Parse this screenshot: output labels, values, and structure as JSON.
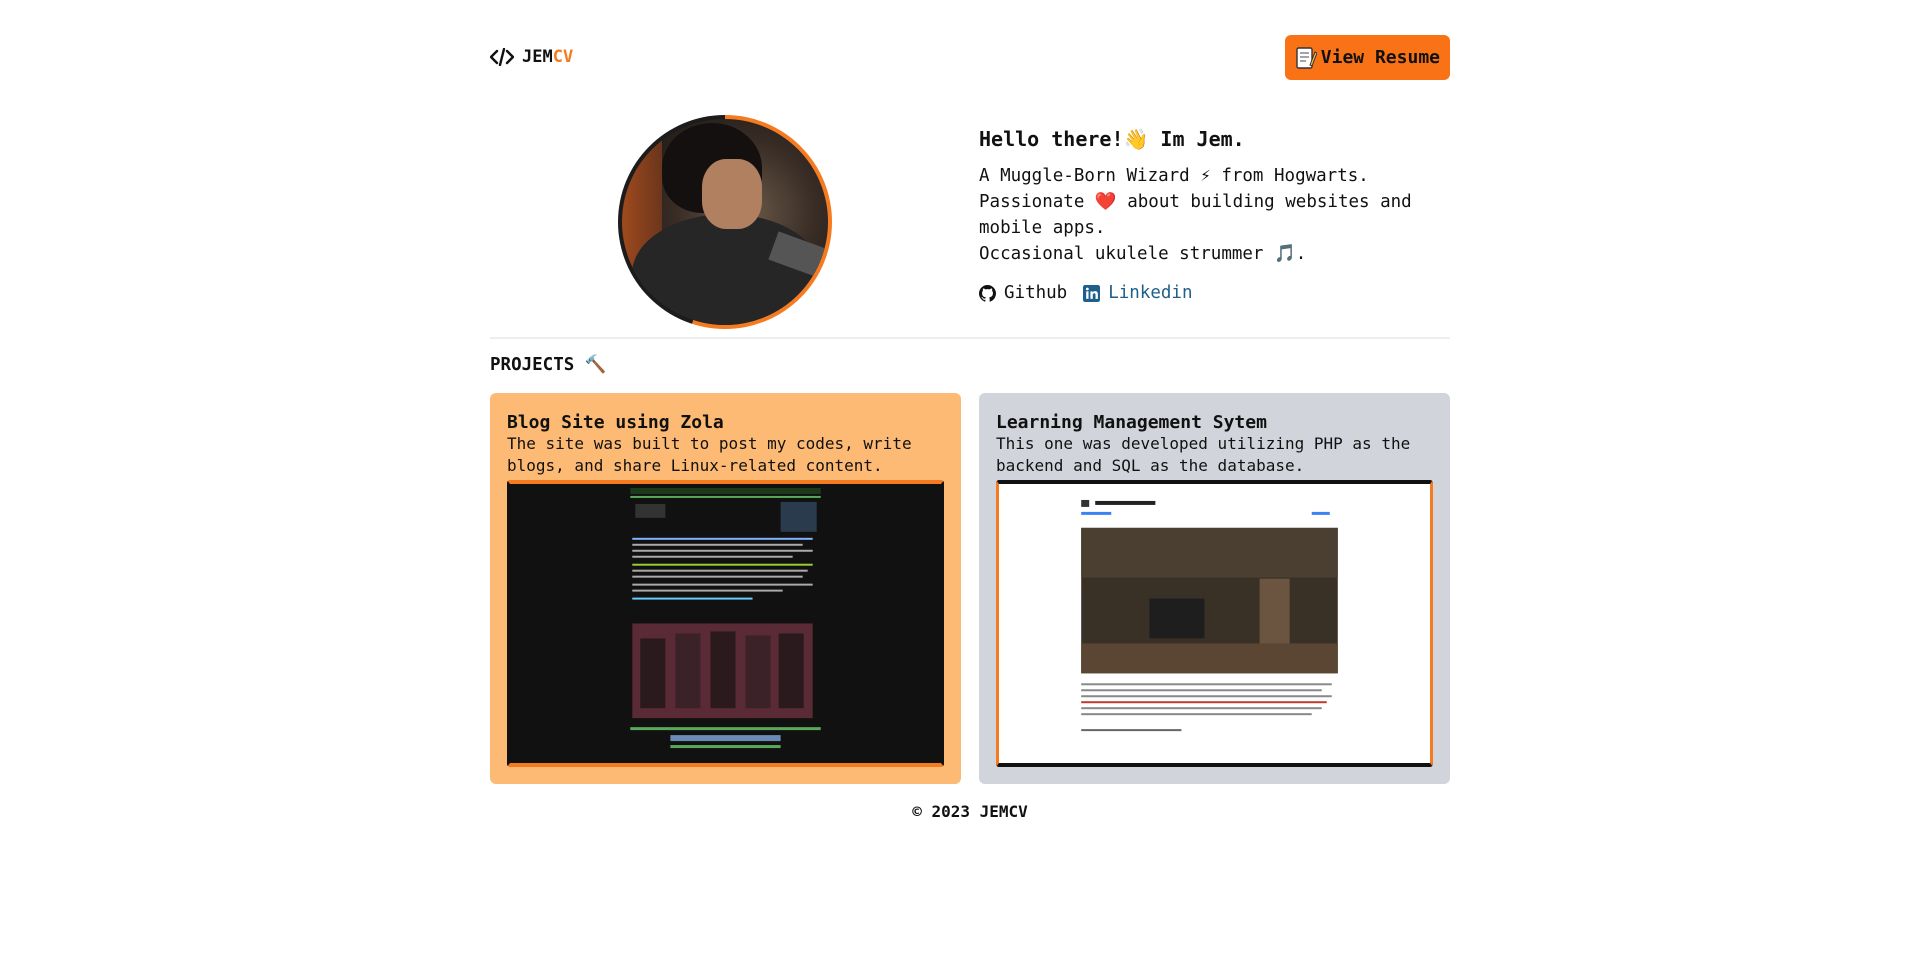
{
  "header": {
    "logo_main": "JEM",
    "logo_accent": "CV",
    "resume_label": "View Resume"
  },
  "hero": {
    "greeting": "Hello there!👋 Im Jem.",
    "line1": "A Muggle-Born Wizard ⚡ from Hogwarts.",
    "line2": "Passionate ❤️ about building websites and mobile apps.",
    "line3": "Occasional ukulele strummer 🎵.",
    "github_label": "Github",
    "linkedin_label": "Linkedin"
  },
  "projects": {
    "title": "PROJECTS 🔨",
    "items": [
      {
        "title": "Blog Site using Zola",
        "description": "The site was built to post my codes, write blogs, and share Linux-related content."
      },
      {
        "title": "Learning Management Sytem",
        "description": "This one was developed utilizing PHP as the backend and SQL as the database."
      }
    ]
  },
  "footer": {
    "text": "© 2023 JEMCV"
  }
}
